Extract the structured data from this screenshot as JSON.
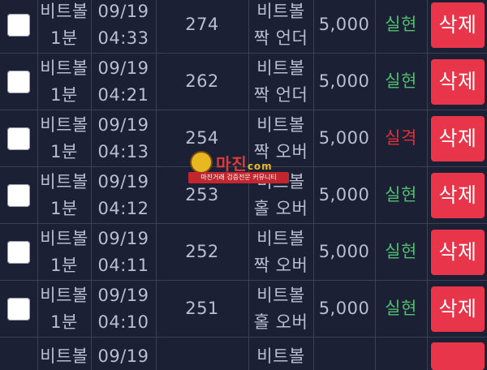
{
  "rows": [
    {
      "game": [
        "비트볼",
        "1분"
      ],
      "date": "09/19",
      "time": "04:33",
      "round": "274",
      "pick": [
        "비트볼",
        "짝 언더"
      ],
      "amount": "5,000",
      "result": "실현",
      "result_type": "win",
      "delete_label": "삭제"
    },
    {
      "game": [
        "비트볼",
        "1분"
      ],
      "date": "09/19",
      "time": "04:21",
      "round": "262",
      "pick": [
        "비트볼",
        "짝 언더"
      ],
      "amount": "5,000",
      "result": "실현",
      "result_type": "win",
      "delete_label": "삭제"
    },
    {
      "game": [
        "비트볼",
        "1분"
      ],
      "date": "09/19",
      "time": "04:13",
      "round": "254",
      "pick": [
        "비트볼",
        "짝 오버"
      ],
      "amount": "5,000",
      "result": "실격",
      "result_type": "lose",
      "delete_label": "삭제"
    },
    {
      "game": [
        "비트볼",
        "1분"
      ],
      "date": "09/19",
      "time": "04:12",
      "round": "253",
      "pick": [
        "비트볼",
        "홀 오버"
      ],
      "amount": "5,000",
      "result": "실현",
      "result_type": "win",
      "delete_label": "삭제"
    },
    {
      "game": [
        "비트볼",
        "1분"
      ],
      "date": "09/19",
      "time": "04:11",
      "round": "252",
      "pick": [
        "비트볼",
        "짝 오버"
      ],
      "amount": "5,000",
      "result": "실현",
      "result_type": "win",
      "delete_label": "삭제"
    },
    {
      "game": [
        "비트볼",
        "1분"
      ],
      "date": "09/19",
      "time": "04:10",
      "round": "251",
      "pick": [
        "비트볼",
        "홀 오버"
      ],
      "amount": "5,000",
      "result": "실현",
      "result_type": "win",
      "delete_label": "삭제"
    }
  ],
  "partial_row": {
    "game": "비트볼",
    "date": "09/19",
    "pick": "비트볼"
  },
  "watermark": {
    "title": "마진",
    "suffix": "com",
    "subtitle": "마진거래 검증전문 커뮤니티"
  },
  "colors": {
    "background": "#1c2034",
    "win": "#4fc06e",
    "lose": "#e0303a",
    "delete_button": "#e8354a"
  }
}
